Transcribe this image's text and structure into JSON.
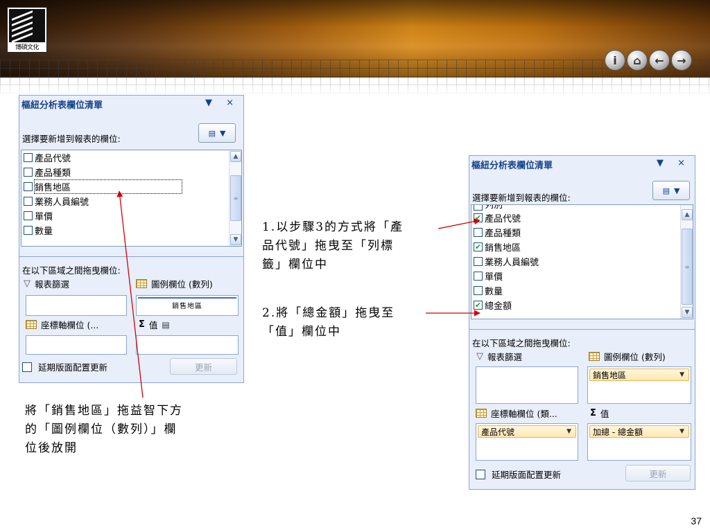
{
  "header": {
    "logo_text": "博碩文化",
    "nav": [
      {
        "name": "info-button",
        "glyph": "i"
      },
      {
        "name": "home-button",
        "glyph": "⌂"
      },
      {
        "name": "back-button",
        "glyph": "←"
      },
      {
        "name": "forward-button",
        "glyph": "→"
      }
    ]
  },
  "left_panel": {
    "title": "樞紐分析表欄位清單",
    "controls": "▼ ×",
    "choose_label": "選擇要新增到報表的欄位:",
    "fields": [
      {
        "label": "產品代號",
        "checked": false
      },
      {
        "label": "產品種類",
        "checked": false
      },
      {
        "label": "銷售地區",
        "checked": false,
        "focused": true
      },
      {
        "label": "業務人員編號",
        "checked": false
      },
      {
        "label": "單價",
        "checked": false
      },
      {
        "label": "數量",
        "checked": false
      }
    ],
    "areas_label": "在以下區域之間拖曳欄位:",
    "filter_label": "報表篩選",
    "column_label": "圖例欄位 (數列)",
    "row_label": "座標軸欄位 (...",
    "values_label": "值",
    "drop_ghost_text": "銷售地區",
    "defer_label": "延期版面配置更新",
    "update_label": "更新"
  },
  "right_panel": {
    "title": "樞紐分析表欄位清單",
    "controls": "▼ ×",
    "choose_label": "選擇要新增到報表的欄位:",
    "fields": [
      {
        "label": "列別",
        "checked": false
      },
      {
        "label": "產品代號",
        "checked": true
      },
      {
        "label": "產品種類",
        "checked": false
      },
      {
        "label": "銷售地區",
        "checked": true
      },
      {
        "label": "業務人員編號",
        "checked": false
      },
      {
        "label": "單價",
        "checked": false
      },
      {
        "label": "數量",
        "checked": false
      },
      {
        "label": "總金額",
        "checked": true
      }
    ],
    "areas_label": "在以下區域之間拖曳欄位:",
    "filter_label": "報表篩選",
    "column_label": "圖例欄位 (數列)",
    "row_label": "座標軸欄位 (類...",
    "values_label": "值",
    "column_chip": "銷售地區",
    "row_chip": "產品代號",
    "values_chip": "加總 - 總金額",
    "defer_label": "延期版面配置更新",
    "update_label": "更新"
  },
  "notes": {
    "step1_line1": "1.以步驟3的方式將「產",
    "step1_line2": "品代號」拖曳至「列標",
    "step1_line3": "籤」欄位中",
    "step2_line1": "2.將「總金額」拖曳至",
    "step2_line2": "「值」欄位中",
    "left_line1": "將「銷售地區」拖益智下方",
    "left_line2": "的「圖例欄位（數列）」欄",
    "left_line3": "位後放開"
  },
  "page_number": "37",
  "colors": {
    "panel_bg": "#e8eefa",
    "panel_title": "#15428b",
    "arrow": "#d40000",
    "chip_bg": "#ffe8b0"
  }
}
